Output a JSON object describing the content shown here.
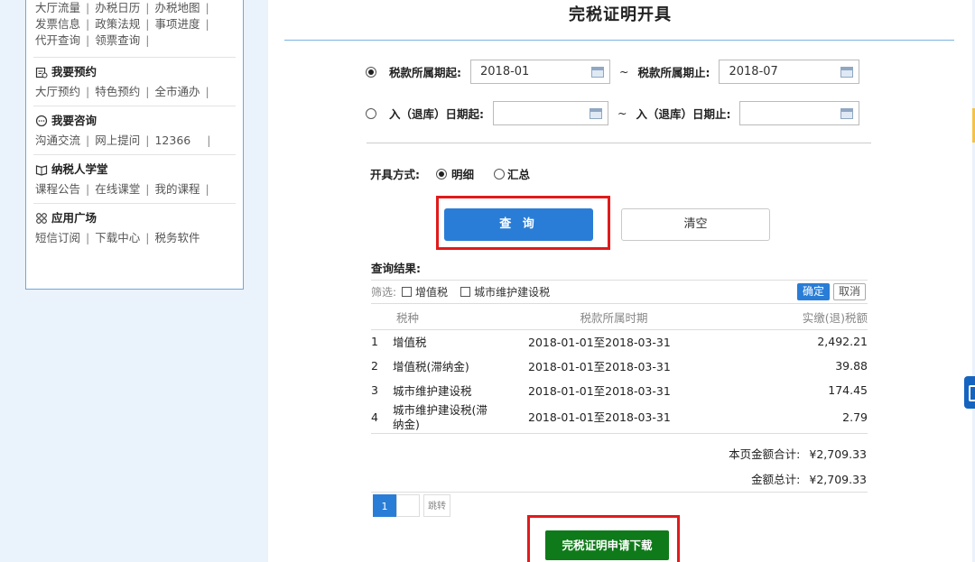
{
  "sidebar": {
    "top_links": [
      "大厅流量",
      "办税日历",
      "办税地图",
      "发票信息",
      "政策法规",
      "事项进度",
      "代开查询",
      "领票查询"
    ],
    "groups": [
      {
        "title": "我要预约",
        "icon": "calendar-icon",
        "links": [
          "大厅预约",
          "特色预约",
          "全市通办"
        ]
      },
      {
        "title": "我要咨询",
        "icon": "chat-icon",
        "links": [
          "沟通交流",
          "网上提问",
          "12366"
        ]
      },
      {
        "title": "纳税人学堂",
        "icon": "book-icon",
        "links": [
          "课程公告",
          "在线课堂",
          "我的课程"
        ]
      },
      {
        "title": "应用广场",
        "icon": "grid-icon",
        "links": [
          "短信订阅",
          "下载中心",
          "税务软件"
        ]
      }
    ]
  },
  "main": {
    "title": "完税证明开具",
    "period": {
      "start_label": "税款所属期起:",
      "start_value": "2018-01",
      "tilde": "~",
      "end_label": "税款所属期止:",
      "end_value": "2018-07"
    },
    "storage": {
      "start_label": "入（退库）日期起:",
      "start_value": "",
      "tilde": "~",
      "end_label": "入（退库）日期止:",
      "end_value": ""
    },
    "issue_method": {
      "label": "开具方式:",
      "options": [
        "明细",
        "汇总"
      ],
      "selected": "明细"
    },
    "query_button": "查 询",
    "clear_button": "清空",
    "result_label": "查询结果:",
    "filter": {
      "label": "筛选:",
      "options": [
        "增值税",
        "城市维护建设税"
      ],
      "ok": "确定",
      "cancel": "取消"
    },
    "table": {
      "headers": [
        "",
        "税种",
        "税款所属时期",
        "实缴(退)税额"
      ],
      "rows": [
        {
          "no": "1",
          "type": "增值税",
          "period": "2018-01-01至2018-03-31",
          "amount": "2,492.21"
        },
        {
          "no": "2",
          "type": "增值税(滞纳金)",
          "period": "2018-01-01至2018-03-31",
          "amount": "39.88"
        },
        {
          "no": "3",
          "type": "城市维护建设税",
          "period": "2018-01-01至2018-03-31",
          "amount": "174.45"
        },
        {
          "no": "4",
          "type": "城市维护建设税(滞纳金)",
          "period": "2018-01-01至2018-03-31",
          "amount": "2.79"
        }
      ]
    },
    "page_total_label": "本页金额合计:",
    "page_total_value": "¥2,709.33",
    "grand_total_label": "金额总计:",
    "grand_total_value": "¥2,709.33",
    "pager": {
      "current": "1",
      "jump": "跳转"
    },
    "download_button": "完税证明申请下载"
  },
  "colors": {
    "primary": "#2a7dd6",
    "download": "#0f7a1a",
    "highlight": "#e01b1b"
  }
}
